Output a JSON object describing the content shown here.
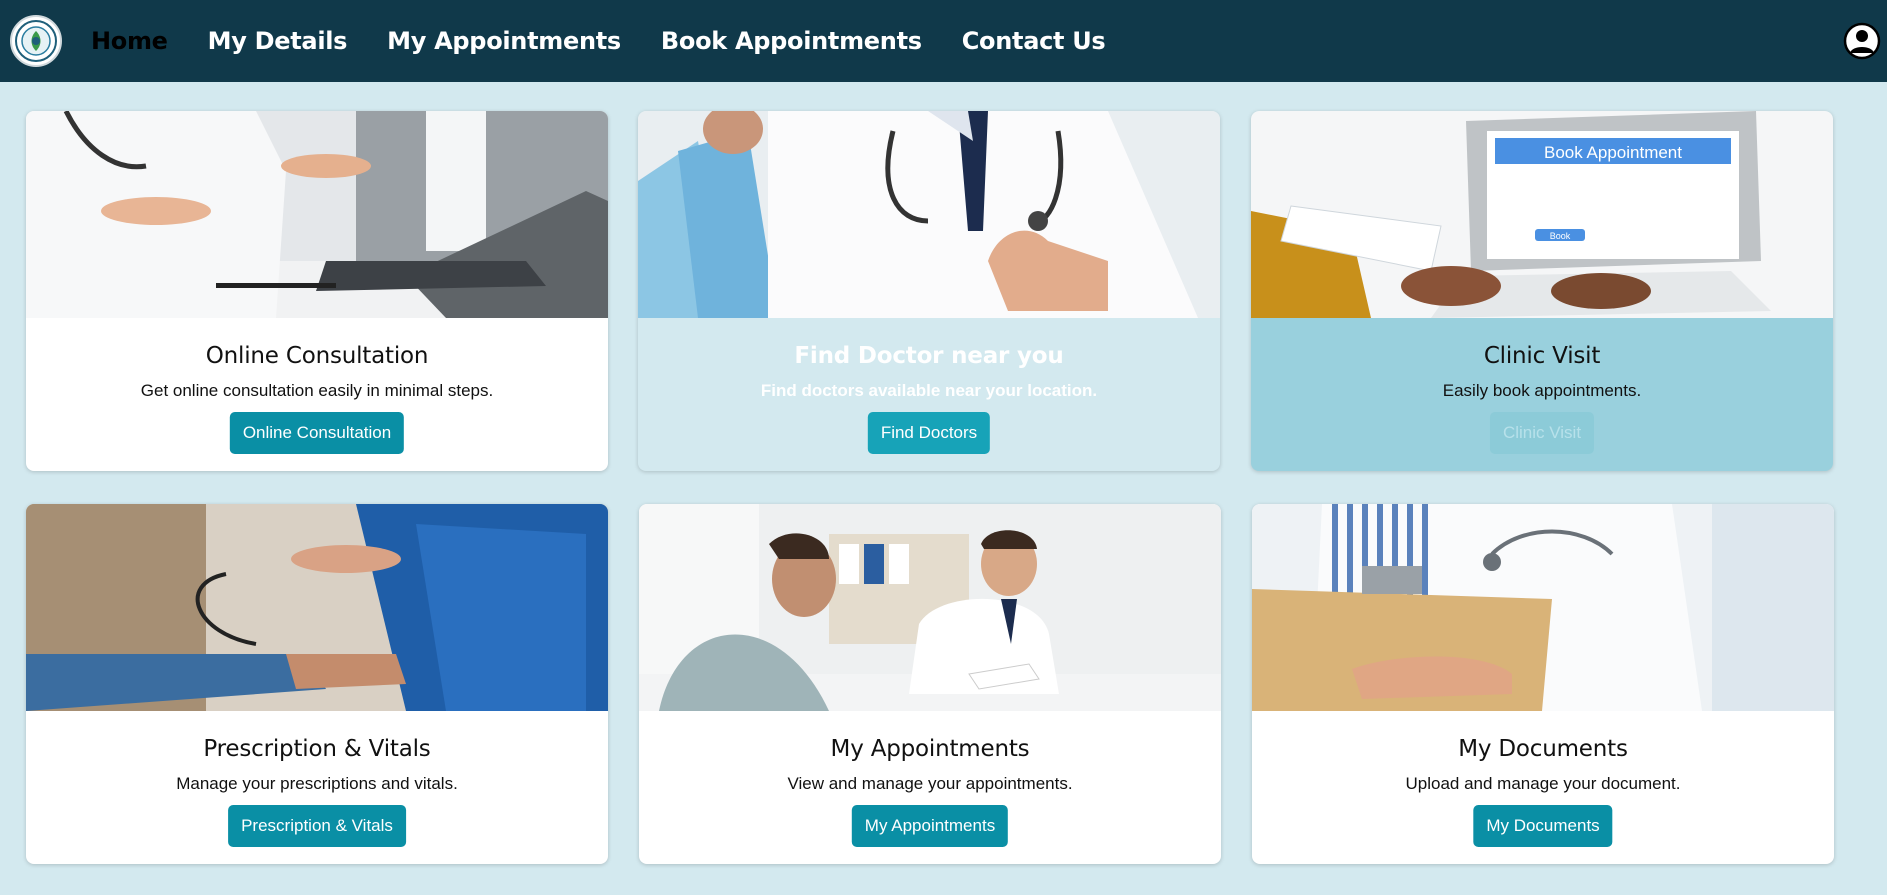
{
  "nav": {
    "links": [
      "Home",
      "My Details",
      "My Appointments",
      "Book Appointments",
      "Contact Us"
    ]
  },
  "cards": [
    {
      "title": "Online Consultation",
      "description": "Get online consultation easily in minimal steps.",
      "button": "Online Consultation"
    },
    {
      "title": "Find Doctor near you",
      "description": "Find doctors available near your location.",
      "button": "Find Doctors"
    },
    {
      "title": "Clinic Visit",
      "description": "Easily book appointments.",
      "button": "Clinic Visit",
      "image_caption": "Book Appointment",
      "image_button": "Book"
    },
    {
      "title": "Prescription & Vitals",
      "description": "Manage your prescriptions and vitals.",
      "button": "Prescription & Vitals"
    },
    {
      "title": "My Appointments",
      "description": "View and manage your appointments.",
      "button": "My Appointments"
    },
    {
      "title": "My Documents",
      "description": "Upload and manage your document.",
      "button": "My Documents"
    }
  ],
  "colors": {
    "navbar": "#10394a",
    "page_background": "#d3e9ef",
    "button": "#0a8fa5"
  },
  "icons": [
    "logo-emblem",
    "user-profile-icon"
  ]
}
